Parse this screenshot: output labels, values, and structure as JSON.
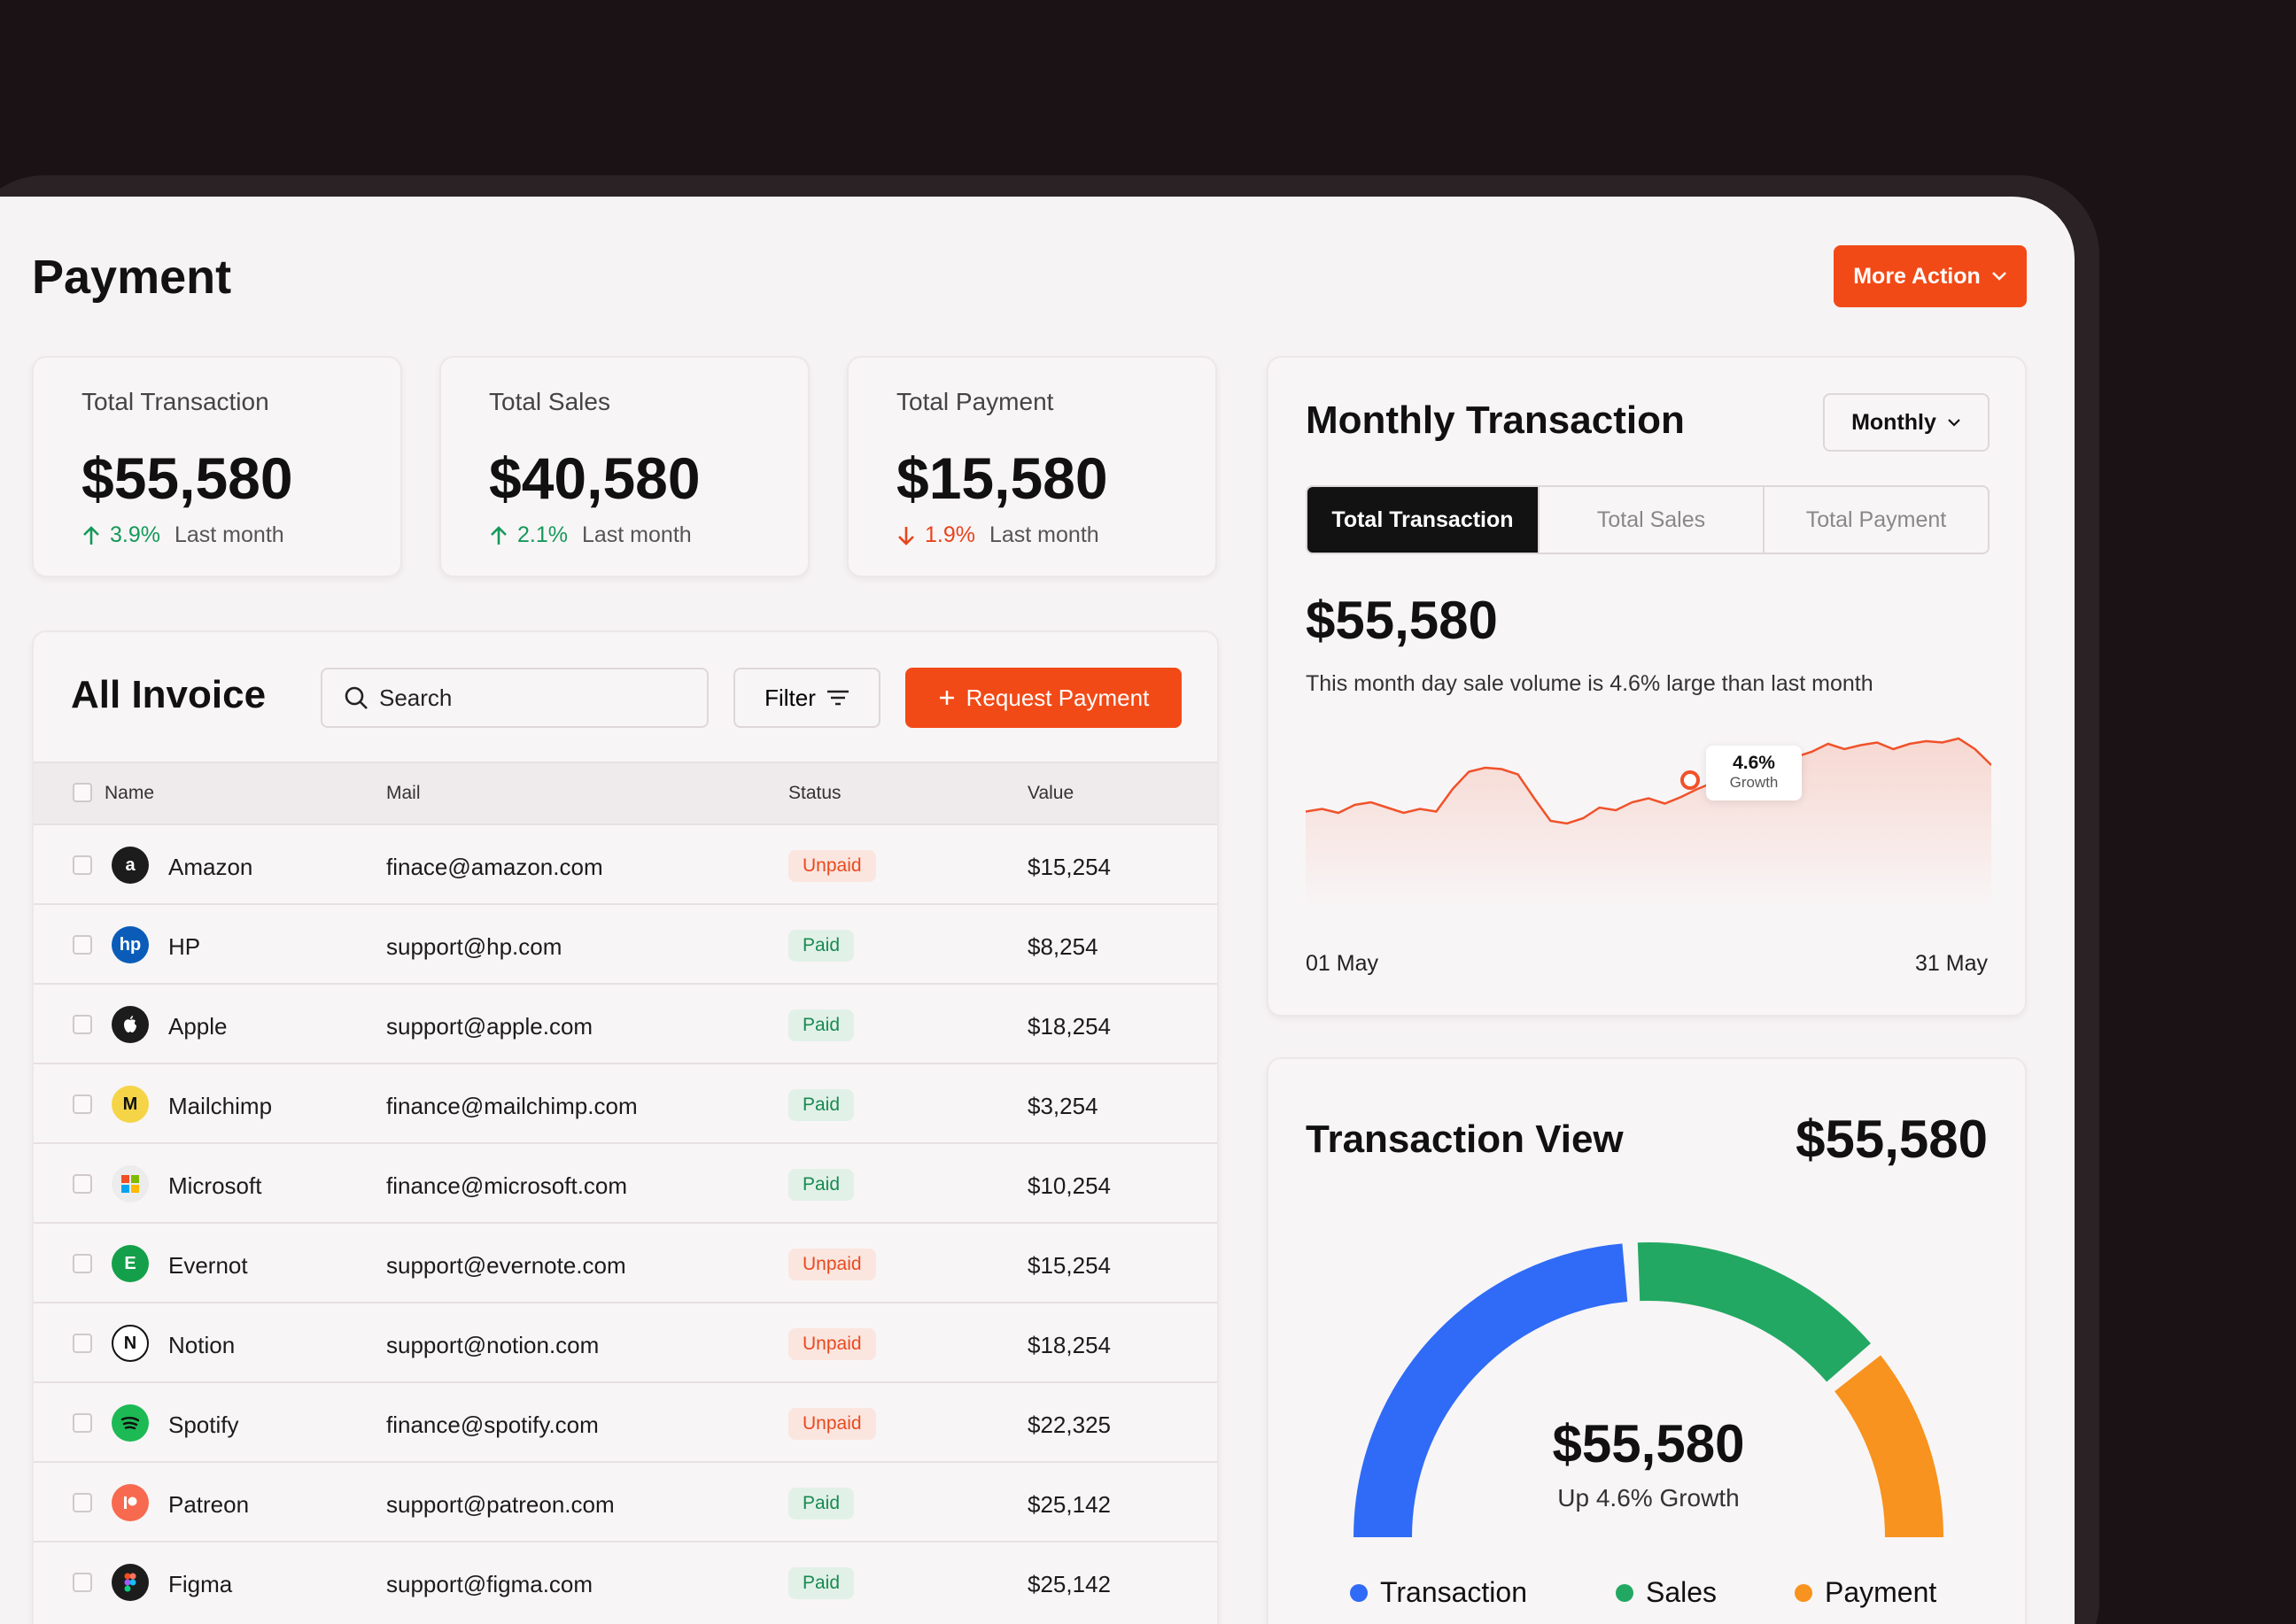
{
  "page": {
    "title": "Payment",
    "more_action": "More Action"
  },
  "stats": [
    {
      "label": "Total Transaction",
      "value": "$55,580",
      "delta": "3.9%",
      "direction": "up",
      "period": "Last month"
    },
    {
      "label": "Total Sales",
      "value": "$40,580",
      "delta": "2.1%",
      "direction": "up",
      "period": "Last month"
    },
    {
      "label": "Total Payment",
      "value": "$15,580",
      "delta": "1.9%",
      "direction": "down",
      "period": "Last month"
    }
  ],
  "invoice": {
    "title": "All Invoice",
    "search_placeholder": "Search",
    "filter_label": "Filter",
    "request_label": "Request Payment",
    "columns": {
      "name": "Name",
      "mail": "Mail",
      "status": "Status",
      "value": "Value"
    },
    "rows": [
      {
        "name": "Amazon",
        "mail": "finace@amazon.com",
        "status": "Unpaid",
        "value": "$15,254"
      },
      {
        "name": "HP",
        "mail": "support@hp.com",
        "status": "Paid",
        "value": "$8,254"
      },
      {
        "name": "Apple",
        "mail": "support@apple.com",
        "status": "Paid",
        "value": "$18,254"
      },
      {
        "name": "Mailchimp",
        "mail": "finance@mailchimp.com",
        "status": "Paid",
        "value": "$3,254"
      },
      {
        "name": "Microsoft",
        "mail": "finance@microsoft.com",
        "status": "Paid",
        "value": "$10,254"
      },
      {
        "name": "Evernot",
        "mail": "support@evernote.com",
        "status": "Unpaid",
        "value": "$15,254"
      },
      {
        "name": "Notion",
        "mail": "support@notion.com",
        "status": "Unpaid",
        "value": "$18,254"
      },
      {
        "name": "Spotify",
        "mail": "finance@spotify.com",
        "status": "Unpaid",
        "value": "$22,325"
      },
      {
        "name": "Patreon",
        "mail": "support@patreon.com",
        "status": "Paid",
        "value": "$25,142"
      },
      {
        "name": "Figma",
        "mail": "support@figma.com",
        "status": "Paid",
        "value": "$25,142"
      }
    ]
  },
  "logos": [
    {
      "icon": "amazon-logo-icon",
      "glyph": "a",
      "bg": "#1c1c1c"
    },
    {
      "icon": "hp-logo-icon",
      "glyph": "hp",
      "bg": "#0a5cb8"
    },
    {
      "icon": "apple-logo-icon",
      "glyph": "",
      "bg": "#1c1c1c"
    },
    {
      "icon": "mailchimp-logo-icon",
      "glyph": "M",
      "bg": "#f5d547"
    },
    {
      "icon": "microsoft-logo-icon",
      "glyph": "",
      "bg": "#ececec"
    },
    {
      "icon": "evernote-logo-icon",
      "glyph": "E",
      "bg": "#14a04a"
    },
    {
      "icon": "notion-logo-icon",
      "glyph": "N",
      "bg": "#ffffff"
    },
    {
      "icon": "spotify-logo-icon",
      "glyph": "",
      "bg": "#1db954"
    },
    {
      "icon": "patreon-logo-icon",
      "glyph": "",
      "bg": "#f76a4f"
    },
    {
      "icon": "figma-logo-icon",
      "glyph": "",
      "bg": "#1c1c1c"
    }
  ],
  "monthly": {
    "title": "Monthly Transaction",
    "period_select": "Monthly",
    "tabs": [
      "Total Transaction",
      "Total Sales",
      "Total Payment"
    ],
    "active_tab": 0,
    "value": "$55,580",
    "description": "This month day sale volume is 4.6% large than last month",
    "tooltip_value": "4.6%",
    "tooltip_label": "Growth",
    "start_label": "01 May",
    "end_label": "31 May"
  },
  "chart_data": {
    "type": "area",
    "series": [
      {
        "values": [
          45,
          47,
          44,
          50,
          52,
          48,
          44,
          47,
          45,
          62,
          75,
          78,
          77,
          73,
          55,
          38,
          36,
          40,
          48,
          46,
          52,
          55,
          51,
          56,
          62,
          67,
          74,
          79,
          80,
          84,
          86,
          90,
          96,
          92,
          95,
          97,
          92,
          96,
          98,
          97,
          100,
          92,
          80
        ]
      }
    ],
    "x_labels": [
      "01 May",
      "31 May"
    ],
    "color": "#f0522a"
  },
  "transaction_view": {
    "title": "Transaction View",
    "total": "$55,580",
    "center_value": "$55,580",
    "center_sub": "Up 4.6% Growth",
    "segments": [
      {
        "name": "Transaction",
        "color": "#2f6bf6",
        "share": 0.48
      },
      {
        "name": "Sales",
        "color": "#22a862",
        "share": 0.3
      },
      {
        "name": "Payment",
        "color": "#f7931e",
        "share": 0.22
      }
    ]
  }
}
